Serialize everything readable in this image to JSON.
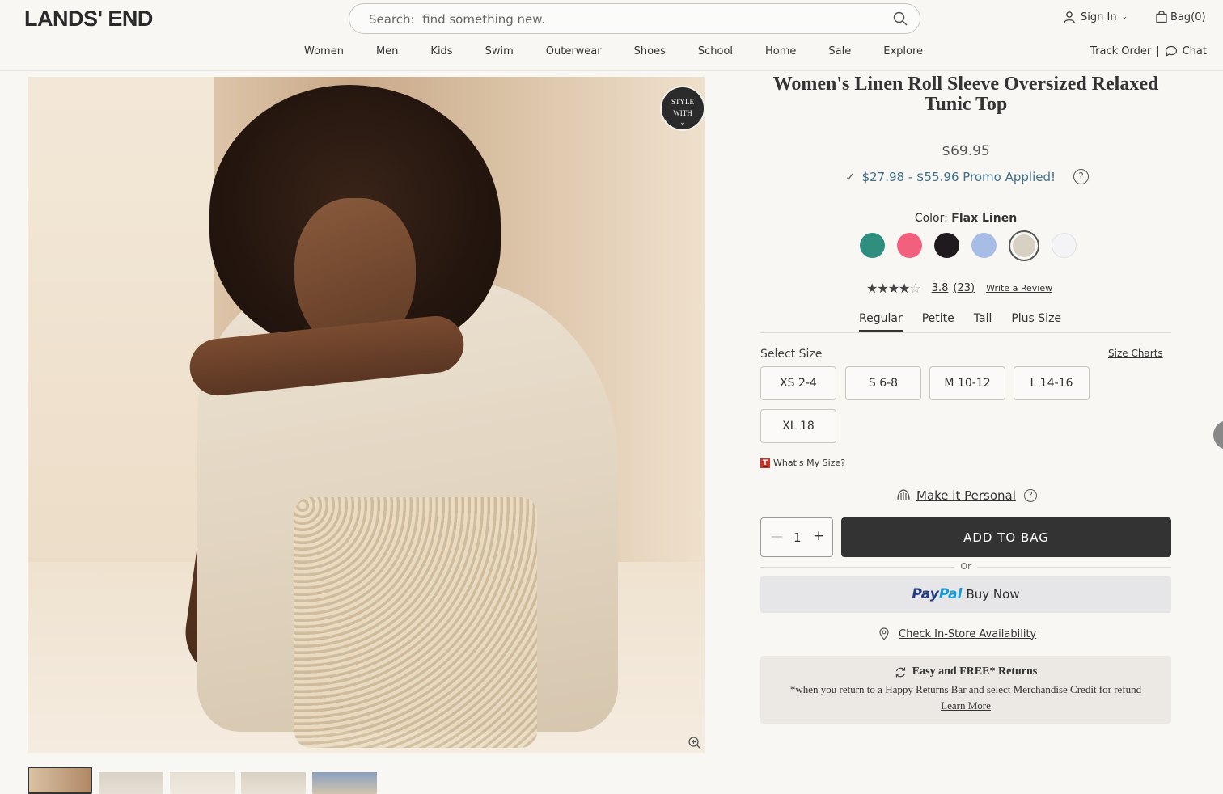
{
  "header": {
    "logo": "LANDS' END",
    "search_placeholder": "Search:  find something new.",
    "sign_in": "Sign In",
    "bag": "Bag(0)",
    "nav": [
      "Women",
      "Men",
      "Kids",
      "Swim",
      "Outerwear",
      "Shoes",
      "School",
      "Home",
      "Sale",
      "Explore"
    ],
    "track_order": "Track Order",
    "chat": "Chat"
  },
  "gallery": {
    "style_with": [
      "STYLE",
      "WITH"
    ],
    "thumbnail_count": 5
  },
  "product": {
    "title": "Women's Linen Roll Sleeve Oversized Relaxed Tunic Top",
    "price": "$69.95",
    "promo": "$27.98 - $55.96 Promo Applied!",
    "color_label": "Color:",
    "color_name": "Flax Linen",
    "swatches": [
      {
        "name": "teal",
        "hex": "#2f8f7f"
      },
      {
        "name": "pink",
        "hex": "#f2607d"
      },
      {
        "name": "black",
        "hex": "#1f1a1d"
      },
      {
        "name": "light-blue",
        "hex": "#a8bde6"
      },
      {
        "name": "flax-linen",
        "hex": "#d9d0c4",
        "selected": true
      },
      {
        "name": "white",
        "hex": "#f4f4f6"
      }
    ],
    "rating_value": 3.8,
    "rating_text": "3.8",
    "review_count": "(23)",
    "write_review": "Write a Review",
    "fit_tabs": [
      "Regular",
      "Petite",
      "Tall",
      "Plus Size"
    ],
    "active_fit": "Regular",
    "select_size": "Select Size",
    "size_charts": "Size Charts",
    "sizes": [
      "XS 2-4",
      "S 6-8",
      "M 10-12",
      "L 14-16",
      "XL 18"
    ],
    "whats_my_size": "What's My Size?",
    "make_personal": "Make it Personal",
    "quantity": "1",
    "add_to_bag": "ADD TO BAG",
    "or": "Or",
    "paypal_a": "Pay",
    "paypal_b": "Pal",
    "paypal_buy": "Buy Now",
    "in_store": "Check In-Store Availability",
    "returns_title": "Easy and FREE* Returns",
    "returns_sub": "*when you return to a Happy Returns Bar and select Merchandise Credit for refund",
    "returns_link": "Learn More"
  }
}
